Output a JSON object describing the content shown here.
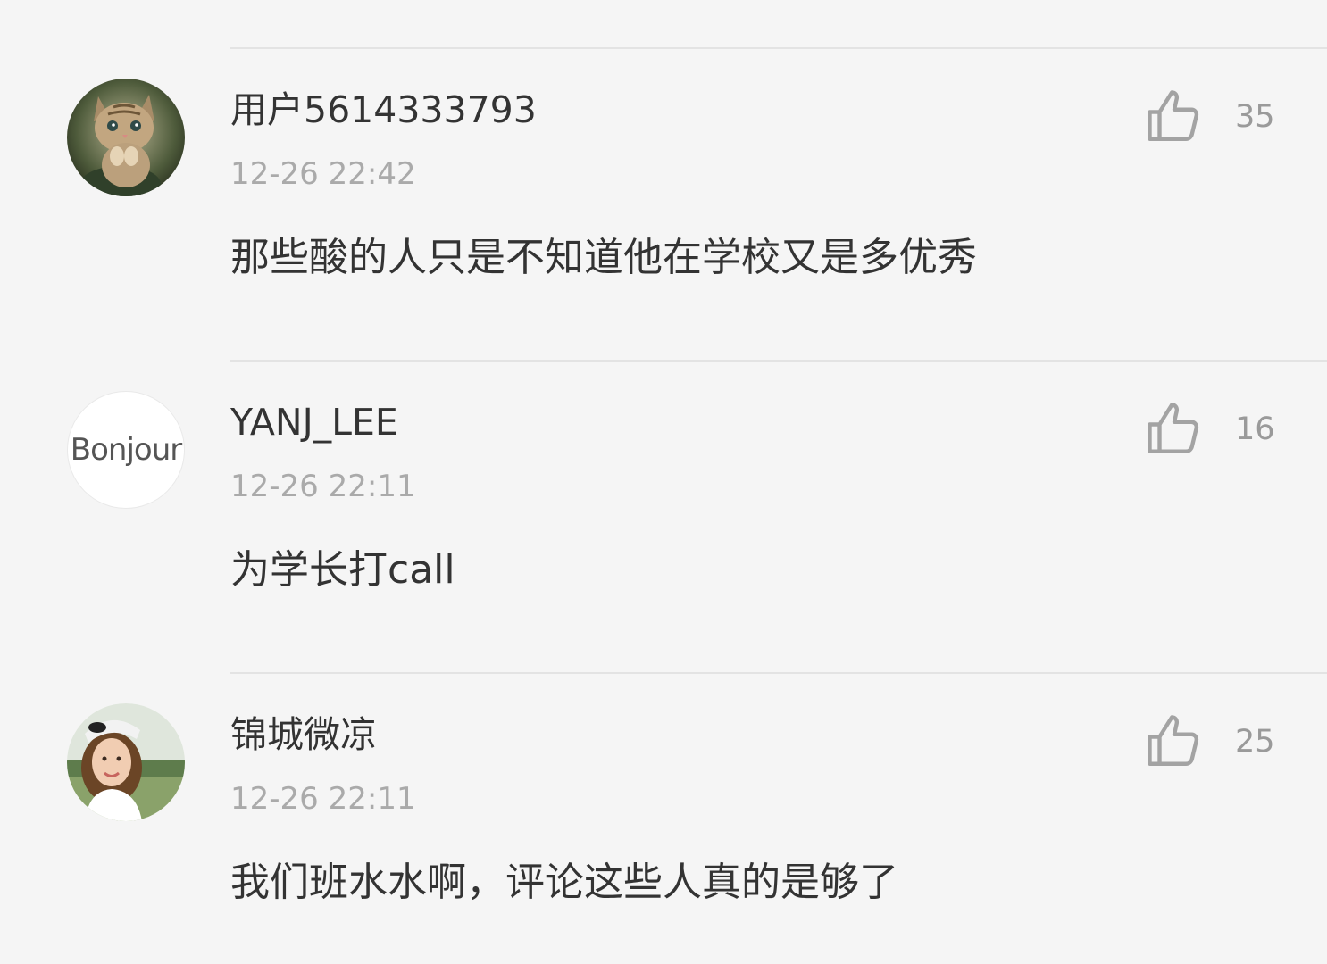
{
  "comments": [
    {
      "username": "用户5614333793",
      "time": "12-26 22:42",
      "content": "那些酸的人只是不知道他在学校又是多优秀",
      "likes": "35",
      "avatar_icon": "cat-avatar"
    },
    {
      "username": "YANJ_LEE",
      "time": "12-26 22:11",
      "content": "为学长打call",
      "likes": "16",
      "avatar_text": "Bonjour"
    },
    {
      "username": "锦城微凉",
      "time": "12-26 22:11",
      "content": "我们班水水啊，评论这些人真的是够了",
      "likes": "25",
      "avatar_icon": "girl-avatar"
    }
  ],
  "colors": {
    "background": "#f5f5f5",
    "divider": "#e3e3e3",
    "username": "#333333",
    "timestamp": "#aaaaaa",
    "content": "#333333",
    "like": "#9a9a9a"
  },
  "icons": {
    "like": "thumbs-up-icon"
  }
}
